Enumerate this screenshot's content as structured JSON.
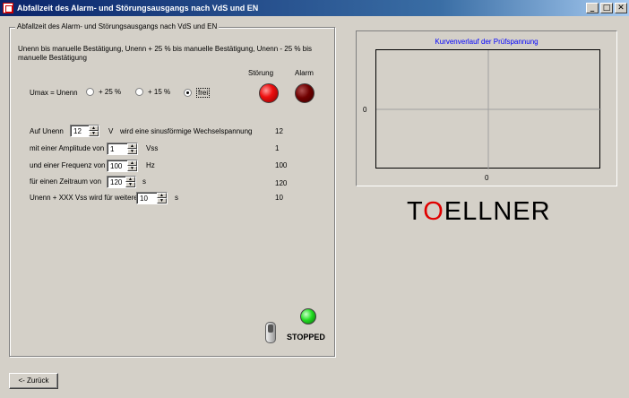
{
  "window": {
    "title": "Abfallzeit des Alarm- und Störungsausgangs nach VdS und EN",
    "buttons": {
      "minimize": "_",
      "maximize": "□",
      "close": "✕"
    }
  },
  "group": {
    "legend": "Abfallzeit des Alarm- und Störungsausgangs nach VdS und EN",
    "description": "Unenn bis manuelle Bestätigung, Unenn + 25 % bis manuelle Bestätigung, Unenn - 25 % bis manuelle Bestätigung"
  },
  "indicators": {
    "stoerung_label": "Störung",
    "alarm_label": "Alarm"
  },
  "umax": {
    "label": "Umax = Unenn",
    "options": [
      {
        "label": "+ 25 %",
        "checked": false
      },
      {
        "label": "+ 15 %",
        "checked": false
      },
      {
        "label": "frei",
        "checked": true
      }
    ]
  },
  "params": [
    {
      "prefix": "Auf Unenn",
      "value": "12",
      "unit": "V",
      "suffix": "wird eine sinusförmige Wechselspannung",
      "readout": "12"
    },
    {
      "prefix": "mit einer Amplitude von",
      "value": "1",
      "unit": "Vss",
      "suffix": "",
      "readout": "1"
    },
    {
      "prefix": "und einer Frequenz von",
      "value": "100",
      "unit": "Hz",
      "suffix": "",
      "readout": "100"
    },
    {
      "prefix": "für einen Zeitraum von",
      "value": "120",
      "unit": "s",
      "suffix": "",
      "readout": "120"
    },
    {
      "prefix": "Unenn + XXX Vss wird für weitere",
      "value": "10",
      "unit": "s",
      "suffix": "",
      "readout": "10"
    }
  ],
  "status": {
    "run_state": "STOPPED",
    "led_color": "#22dd22"
  },
  "chart": {
    "title": "Kurvenverlauf der Prüfspannung",
    "y_tick": "0",
    "x_tick": "0"
  },
  "logo": {
    "prefix": "T",
    "accent": "O",
    "rest": "ELLNER"
  },
  "footer": {
    "back_label": "<- Zurück"
  },
  "colors": {
    "chart_title": "#0000ff",
    "logo_accent": "#e00000"
  }
}
